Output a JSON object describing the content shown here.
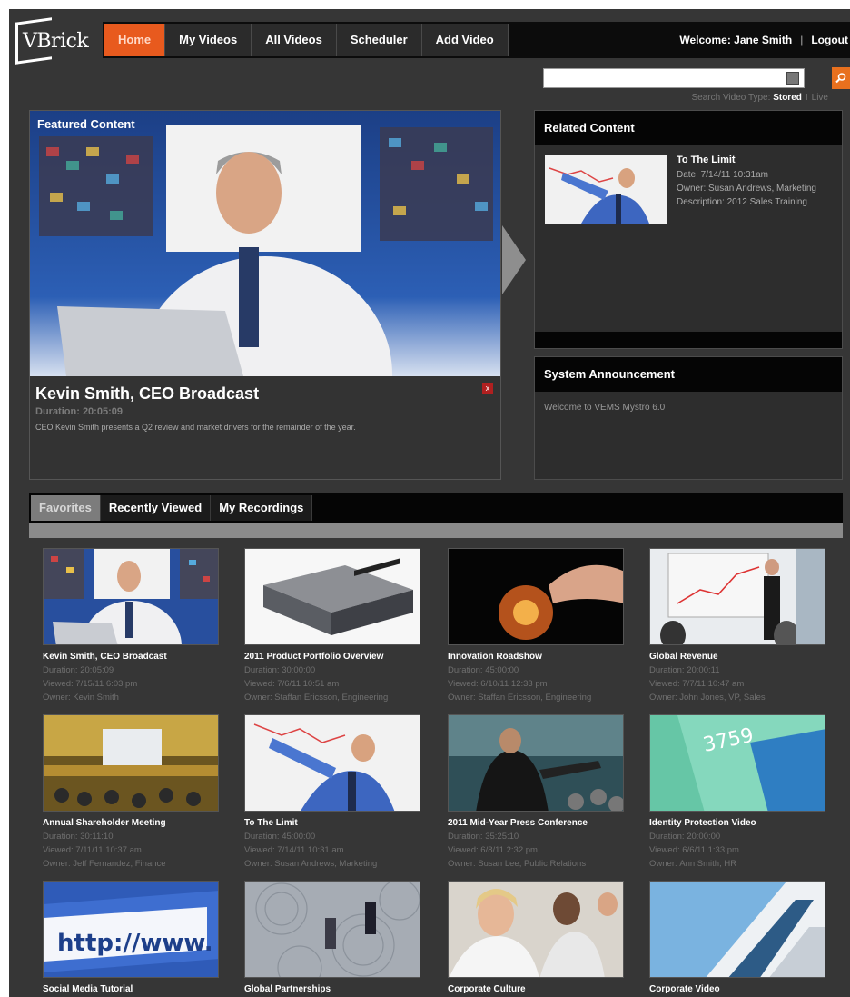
{
  "app": {
    "logo_text": "VBrick"
  },
  "nav": {
    "tabs": [
      {
        "label": "Home",
        "active": true
      },
      {
        "label": "My Videos",
        "active": false
      },
      {
        "label": "All Videos",
        "active": false
      },
      {
        "label": "Scheduler",
        "active": false
      },
      {
        "label": "Add Video",
        "active": false
      }
    ],
    "welcome": "Welcome: Jane Smith",
    "separator": "|",
    "logout": "Logout"
  },
  "search": {
    "value": "",
    "type_label": "Search Video Type:",
    "type_stored": "Stored",
    "type_sep": "I",
    "type_live": "Live",
    "button_icon": "search-icon"
  },
  "featured": {
    "label": "Featured Content",
    "title": "Kevin Smith, CEO Broadcast",
    "duration": "Duration: 20:05:09",
    "description": "CEO Kevin Smith presents a Q2 review and market drivers for the remainder of the year.",
    "close_glyph": "x"
  },
  "related": {
    "heading": "Related Content",
    "title": "To The Limit",
    "date": "Date: 7/14/11 10:31am",
    "owner": "Owner: Susan Andrews, Marketing",
    "description": "Description: 2012 Sales Training"
  },
  "announcement": {
    "heading": "System Announcement",
    "text": "Welcome to VEMS Mystro 6.0"
  },
  "tabs": [
    {
      "label": "Favorites",
      "active": true
    },
    {
      "label": "Recently Viewed",
      "active": false
    },
    {
      "label": "My Recordings",
      "active": false
    }
  ],
  "videos": [
    {
      "title": "Kevin Smith, CEO Broadcast",
      "duration_label": "Duration:",
      "duration": "20:05:09",
      "viewed_label": "Viewed:",
      "viewed": "7/15/11 6:03 pm",
      "owner_label": "Owner:",
      "owner": "Kevin Smith"
    },
    {
      "title": "2011 Product Portfolio Overview",
      "duration_label": "Duration:",
      "duration": "30:00:00",
      "viewed_label": "Viewed:",
      "viewed": "7/6/11 10:51 am",
      "owner_label": "Owner:",
      "owner": "Staffan Ericsson, Engineering"
    },
    {
      "title": "Innovation Roadshow",
      "duration_label": "Duration:",
      "duration": "45:00:00",
      "viewed_label": "Viewed:",
      "viewed": "6/10/11 12:33 pm",
      "owner_label": "Owner:",
      "owner": "Staffan Ericsson, Engineering"
    },
    {
      "title": "Global Revenue",
      "duration_label": "Duration:",
      "duration": "20:00:11",
      "viewed_label": "Viewed:",
      "viewed": "7/7/11 10:47 am",
      "owner_label": "Owner:",
      "owner": "John Jones, VP, Sales"
    },
    {
      "title": "Annual Shareholder Meeting",
      "duration_label": "Duration:",
      "duration": "30:11:10",
      "viewed_label": "Viewed:",
      "viewed": "7/11/11 10:37 am",
      "owner_label": "Owner:",
      "owner": "Jeff Fernandez, Finance"
    },
    {
      "title": "To The Limit",
      "duration_label": "Duration:",
      "duration": "45:00:00",
      "viewed_label": "Viewed:",
      "viewed": "7/14/11 10:31 am",
      "owner_label": "Owner:",
      "owner": "Susan Andrews, Marketing"
    },
    {
      "title": "2011 Mid-Year Press Conference",
      "duration_label": "Duration:",
      "duration": "35:25:10",
      "viewed_label": "Viewed:",
      "viewed": "6/8/11 2:32 pm",
      "owner_label": "Owner:",
      "owner": "Susan Lee, Public Relations"
    },
    {
      "title": "Identity Protection Video",
      "duration_label": "Duration:",
      "duration": "20:00:00",
      "viewed_label": "Viewed:",
      "viewed": "6/6/11 1:33 pm",
      "owner_label": "Owner:",
      "owner": "Ann Smith, HR"
    },
    {
      "title": "Social Media Tutorial"
    },
    {
      "title": "Global Partnerships"
    },
    {
      "title": "Corporate Culture"
    },
    {
      "title": "Corporate Video"
    }
  ],
  "thumb_text": {
    "social_media": "http://www.",
    "identity": "3759"
  }
}
